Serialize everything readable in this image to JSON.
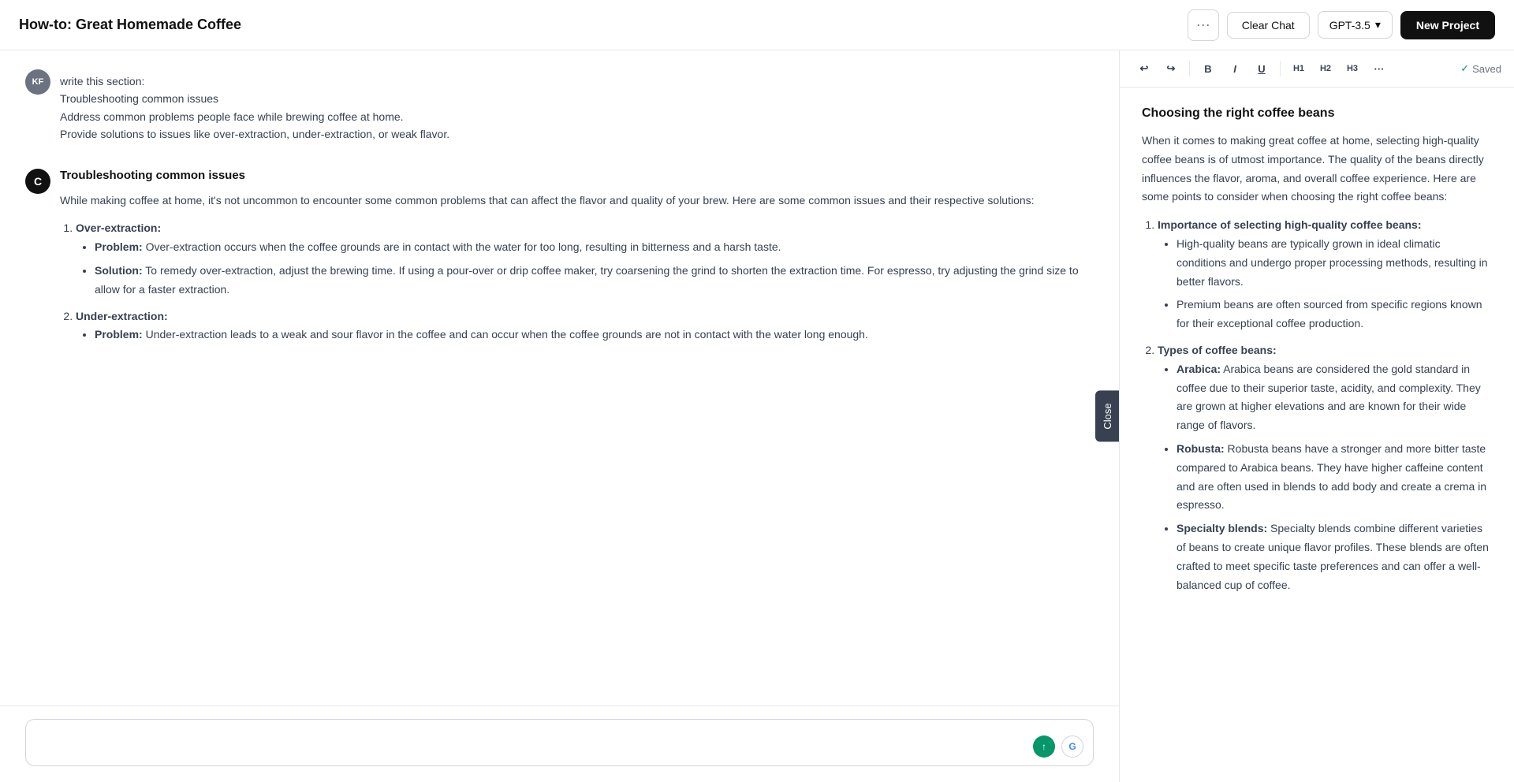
{
  "header": {
    "title": "How-to: Great Homemade Coffee",
    "dots_label": "···",
    "clear_chat_label": "Clear Chat",
    "model_label": "GPT-3.5",
    "chevron": "▾",
    "new_project_label": "New Project"
  },
  "toolbar": {
    "undo": "↩",
    "redo": "↪",
    "bold": "B",
    "italic": "I",
    "underline": "U",
    "h1": "H1",
    "h2": "H2",
    "h3": "H3",
    "more": "···",
    "saved_label": "✓ Saved"
  },
  "chat": {
    "user_initials": "KF",
    "user_message_lines": [
      "write this section:",
      "Troubleshooting common issues",
      "Address common problems people face while brewing coffee at home.",
      "Provide solutions to issues like over-extraction, under-extraction, or weak flavor."
    ],
    "ai_section_title": "Troubleshooting common issues",
    "ai_intro": "While making coffee at home, it's not uncommon to encounter some common problems that can affect the flavor and quality of your brew. Here are some common issues and their respective solutions:",
    "ai_items": [
      {
        "heading": "Over-extraction:",
        "sub": [
          {
            "label": "Problem:",
            "text": " Over-extraction occurs when the coffee grounds are in contact with the water for too long, resulting in bitterness and a harsh taste."
          },
          {
            "label": "Solution:",
            "text": " To remedy over-extraction, adjust the brewing time. If using a pour-over or drip coffee maker, try coarsening the grind to shorten the extraction time. For espresso, try adjusting the grind size to allow for a faster extraction."
          }
        ]
      },
      {
        "heading": "Under-extraction:",
        "sub": [
          {
            "label": "Problem:",
            "text": " Under-extraction leads to a weak and sour flavor in the coffee and can occur when the coffee grounds are not in contact with the water long enough."
          }
        ]
      }
    ],
    "close_tab_label": "Close",
    "input_placeholder": "",
    "icon_1": "⬆",
    "icon_g": "G"
  },
  "editor": {
    "heading": "Choosing the right coffee beans",
    "intro": "When it comes to making great coffee at home, selecting high-quality coffee beans is of utmost importance. The quality of the beans directly influences the flavor, aroma, and overall coffee experience. Here are some points to consider when choosing the right coffee beans:",
    "sections": [
      {
        "heading": "1. Importance of selecting high-quality coffee beans:",
        "bullets": [
          "High-quality beans are typically grown in ideal climatic conditions and undergo proper processing methods, resulting in better flavors.",
          "Premium beans are often sourced from specific regions known for their exceptional coffee production."
        ]
      },
      {
        "heading": "2. Types of coffee beans:",
        "bullets": [
          "Arabica: Arabica beans are considered the gold standard in coffee due to their superior taste, acidity, and complexity. They are grown at higher elevations and are known for their wide range of flavors.",
          "Robusta: Robusta beans have a stronger and more bitter taste compared to Arabica beans. They have higher caffeine content and are often used in blends to add body and create a crema in espresso.",
          "Specialty blends: Specialty blends combine different varieties of beans to create unique flavor profiles. These blends are often crafted to meet specific taste preferences and can offer a well-balanced cup of coffee."
        ]
      }
    ]
  }
}
